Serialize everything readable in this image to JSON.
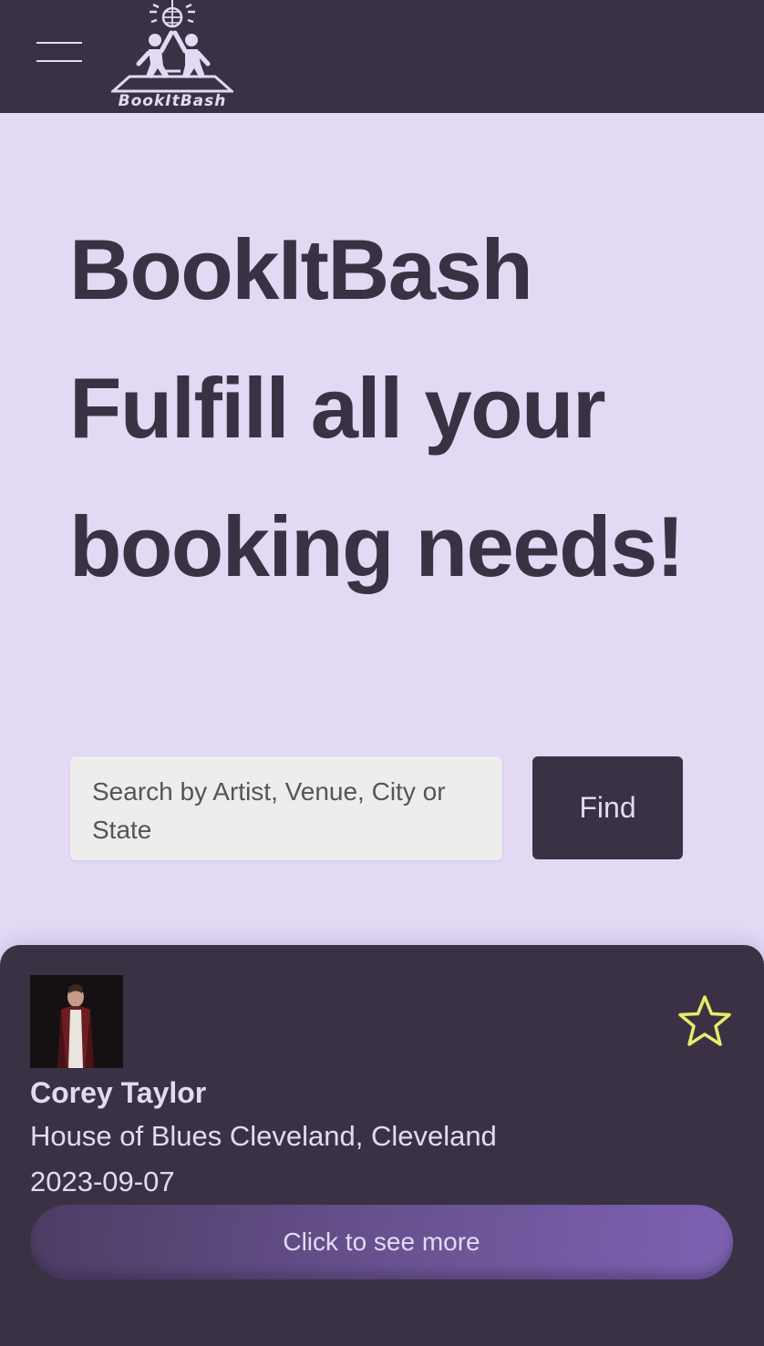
{
  "header": {
    "logo_text": "BookItBash"
  },
  "hero": {
    "line1": "BookItBash",
    "line2": "Fulfill all your",
    "line3": "booking needs!"
  },
  "search": {
    "placeholder": "Search by Artist, Venue, City or State",
    "value": "",
    "button_label": "Find"
  },
  "event_card": {
    "artist": "Corey Taylor",
    "venue": "House of Blues Cleveland, Cleveland",
    "date": "2023-09-07",
    "more_label": "Click to see more",
    "favorite_icon": "star-outline-icon",
    "star_color": "#e8ec6a"
  },
  "colors": {
    "background": "#e3d9f5",
    "dark": "#3a3244",
    "accent": "#7d62b3"
  }
}
